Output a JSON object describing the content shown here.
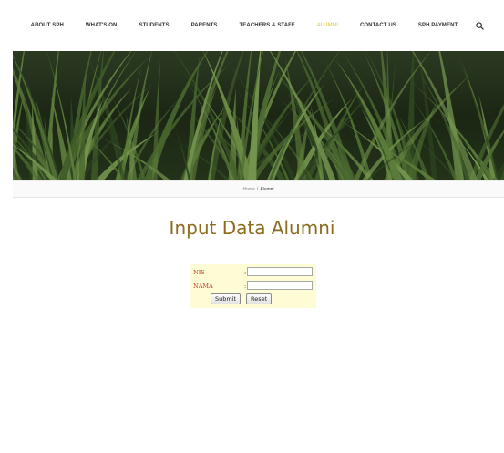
{
  "nav": {
    "items": [
      {
        "label": "ABOUT SPH",
        "active": false
      },
      {
        "label": "WHAT'S ON",
        "active": false
      },
      {
        "label": "STUDENTS",
        "active": false
      },
      {
        "label": "PARENTS",
        "active": false
      },
      {
        "label": "TEACHERS & STAFF",
        "active": false
      },
      {
        "label": "ALUMNI",
        "active": true
      },
      {
        "label": "CONTACT US",
        "active": false
      },
      {
        "label": "SPH PAYMENT",
        "active": false
      }
    ],
    "search_icon": "search-icon"
  },
  "breadcrumb": {
    "home": "Home",
    "separator": "/",
    "current": "Alumni"
  },
  "page": {
    "title": "Input Data Alumni"
  },
  "form": {
    "fields": [
      {
        "label": "NIS",
        "colon": ":",
        "value": ""
      },
      {
        "label": "NAMA",
        "colon": ":",
        "value": ""
      }
    ],
    "submit_label": "Submit",
    "reset_label": "Reset"
  },
  "colors": {
    "active_nav": "#d6c232",
    "title": "#8b6b1e",
    "form_background": "#fefcd4",
    "field_label": "#c0392b"
  }
}
